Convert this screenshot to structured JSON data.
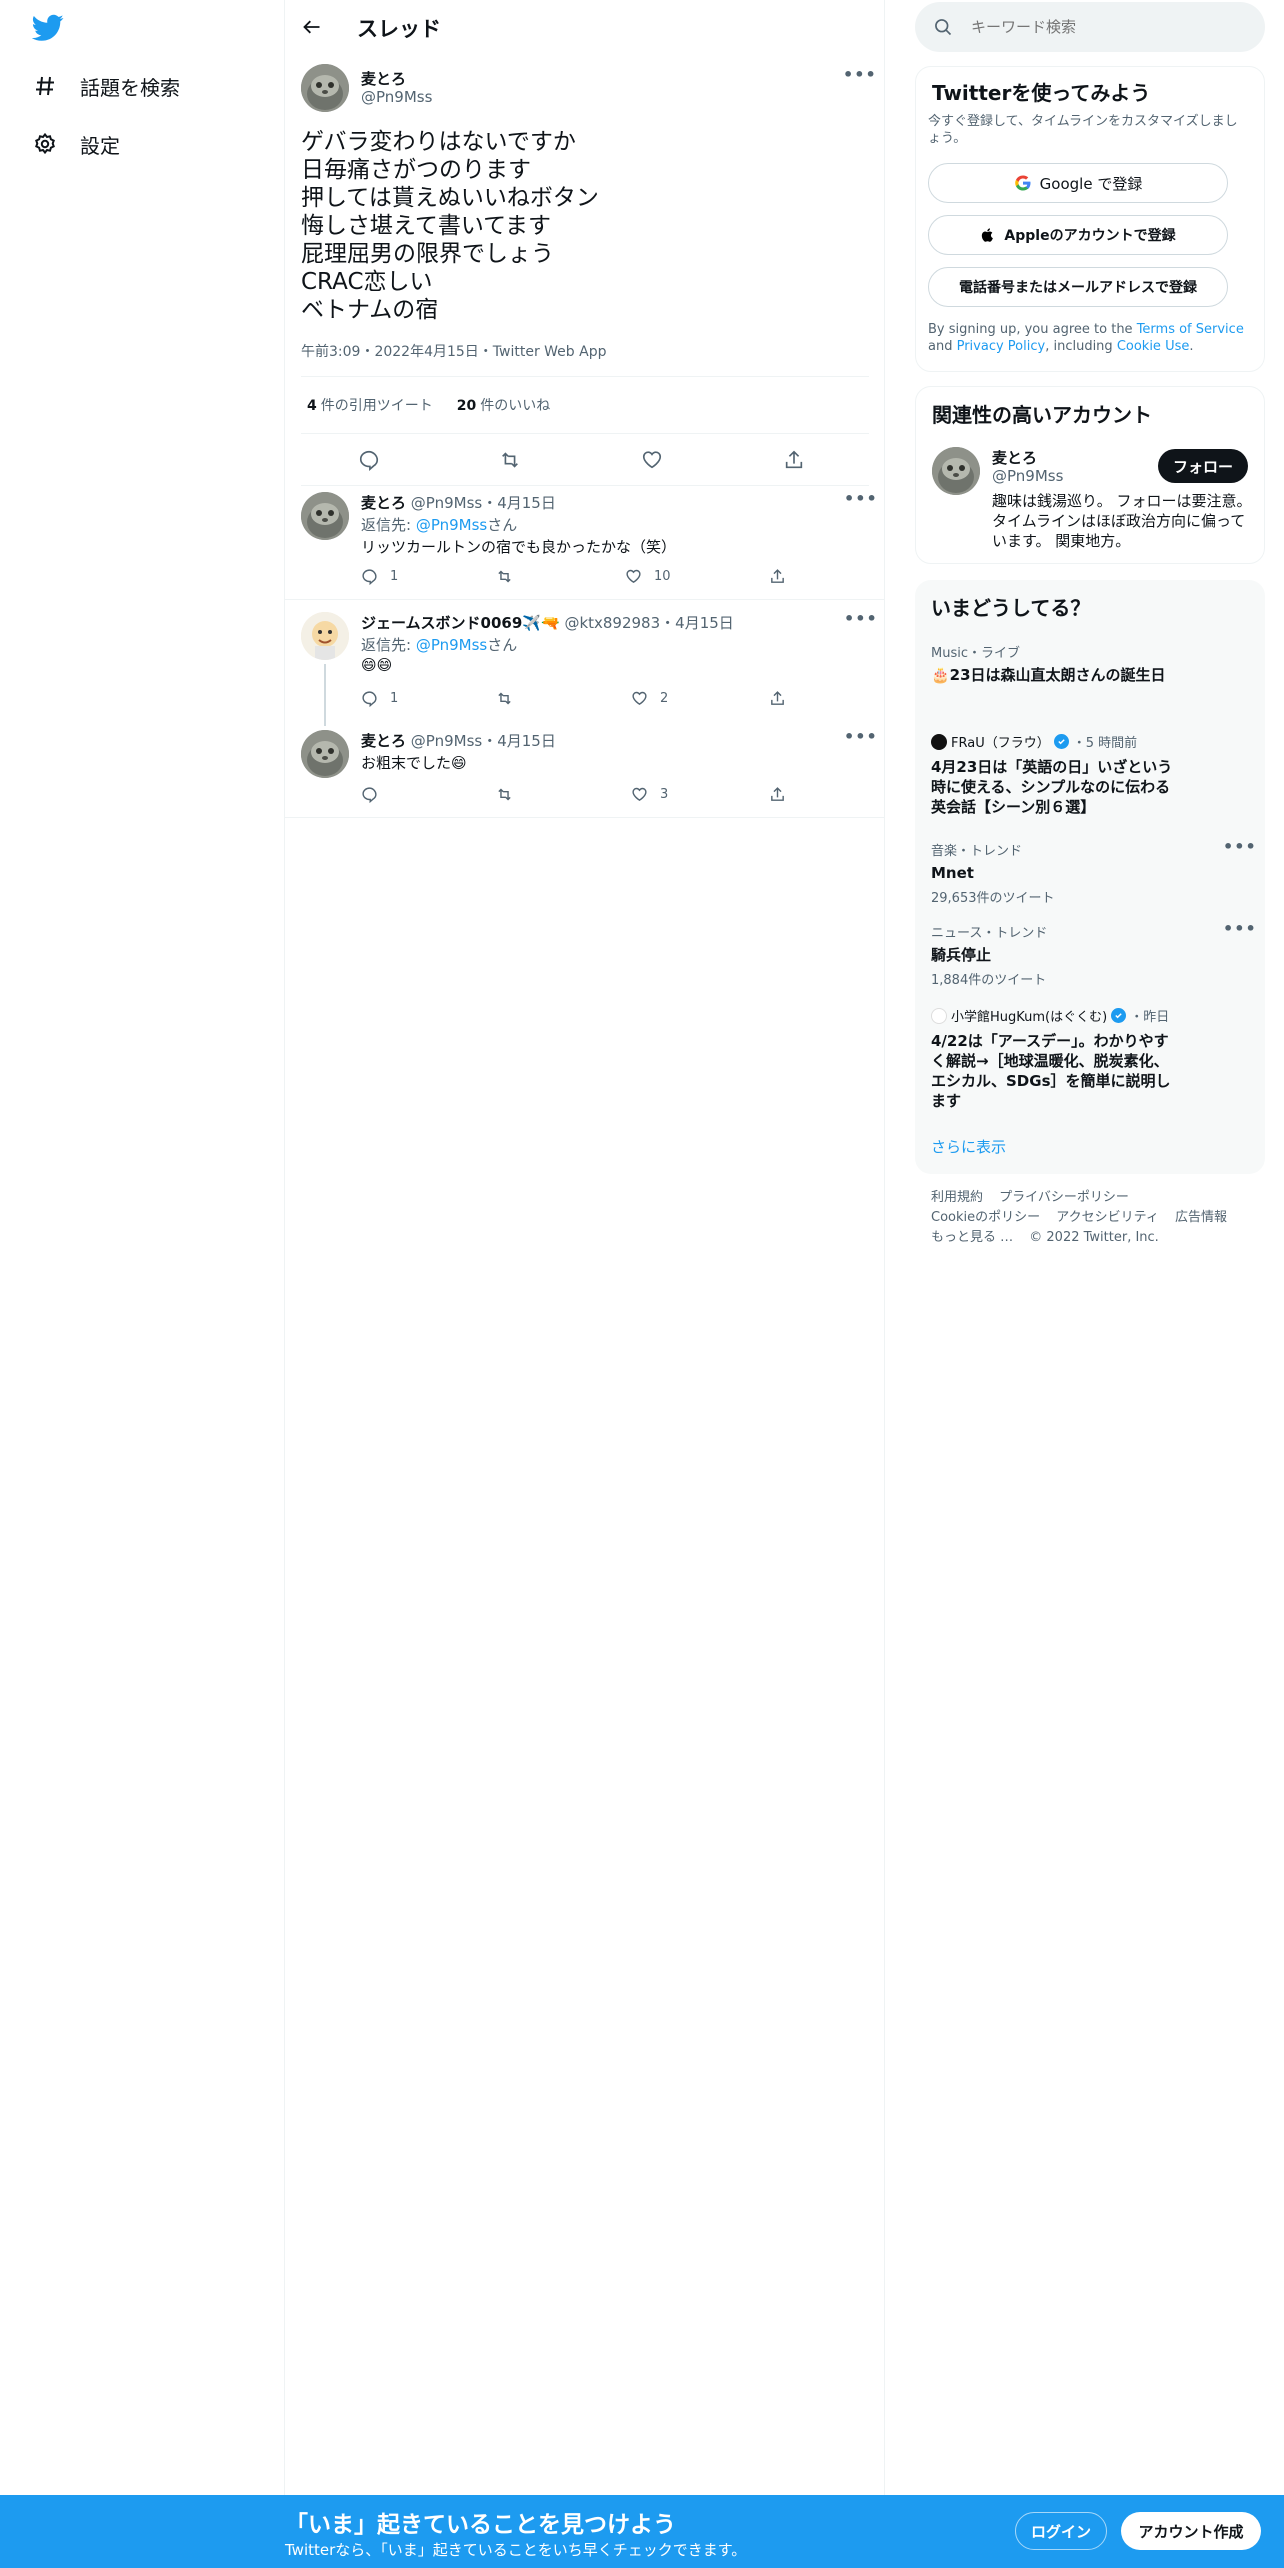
{
  "nav": {
    "items": [
      {
        "label": "話題を検索",
        "icon": "hash-icon"
      },
      {
        "label": "設定",
        "icon": "gear-icon"
      }
    ]
  },
  "header": {
    "title": "スレッド"
  },
  "tweet": {
    "name": "麦とろ",
    "handle": "@Pn9Mss",
    "text": "ゲバラ変わりはないですか\n日毎痛さがつのります\n押しては貰えぬいいねボタン\n悔しさ堪えて書いてます\n屁理屈男の限界でしょう\nCRAC恋しい\nベトナムの宿",
    "meta": "午前3:09・2022年4月15日・Twitter Web App",
    "quote_count": "4",
    "quote_label": "件の引用ツイート",
    "like_count": "20",
    "like_label": "件のいいね"
  },
  "replies": [
    {
      "name": "麦とろ",
      "handle": "@Pn9Mss",
      "date": "・4月15日",
      "reply_prefix": "返信先: ",
      "reply_to": "@Pn9Mss",
      "reply_suffix": "さん",
      "body": "リッツカールトンの宿でも良かったかな（笑）",
      "reply_count": "1",
      "retweet_count": "",
      "like_count": "10"
    },
    {
      "name": "ジェームスボンド0069✈️🔫",
      "handle": "@ktx892983",
      "date": "・4月15日",
      "reply_prefix": "返信先: ",
      "reply_to": "@Pn9Mss",
      "reply_suffix": "さん",
      "body": "😄😄",
      "reply_count": "1",
      "retweet_count": "",
      "like_count": "2"
    },
    {
      "name": "麦とろ",
      "handle": "@Pn9Mss",
      "date": "・4月15日",
      "body": "お粗末でした😄",
      "reply_count": "",
      "retweet_count": "",
      "like_count": "3"
    }
  ],
  "search": {
    "placeholder": "キーワード検索"
  },
  "signup": {
    "title": "Twitterを使ってみよう",
    "subtitle": "今すぐ登録して、タイムラインをカスタマイズしましょう。",
    "google": "Google で登録",
    "apple": "Appleのアカウントで登録",
    "phone": "電話番号またはメールアドレスで登録",
    "terms_1": "By signing up, you agree to the ",
    "terms_link1": "Terms of Service",
    "terms_2": " and ",
    "terms_link2": "Privacy Policy",
    "terms_3": ", including ",
    "terms_link3": "Cookie Use",
    "terms_4": "."
  },
  "related": {
    "title": "関連性の高いアカウント",
    "name": "麦とろ",
    "handle": "@Pn9Mss",
    "follow": "フォロー",
    "bio": "趣味は銭湯巡り。 フォローは要注意。タイムラインはほぼ政治方向に偏っています。 関東地方。"
  },
  "trends": {
    "title": "いまどうしてる？",
    "items": [
      {
        "context": "Music・ライブ",
        "title": "🎂23日は森山直太朗さんの誕生日",
        "count": ""
      },
      {
        "source": "FRaU（フラウ）",
        "time": "・5 時間前",
        "title": "4月23日は「英語の日」いざという時に使える、シンプルなのに伝わる英会話【シーン別６選】"
      },
      {
        "context": "音楽・トレンド",
        "title": "Mnet",
        "count": "29,653件のツイート"
      },
      {
        "context": "ニュース・トレンド",
        "title": "騎兵停止",
        "count": "1,884件のツイート"
      },
      {
        "source": "小学館HugKum(はぐくむ)",
        "time": "・昨日",
        "title": "4/22は「アースデー」。わかりやすく解説→［地球温暖化、脱炭素化、エシカル、SDGs］を簡単に説明します"
      }
    ],
    "show_more": "さらに表示"
  },
  "footer": {
    "links": [
      "利用規約",
      "プライバシーポリシー",
      "Cookieのポリシー",
      "アクセシビリティ",
      "広告情報",
      "もっと見る …",
      "© 2022 Twitter, Inc."
    ]
  },
  "banner": {
    "title": "「いま」起きていることを見つけよう",
    "subtitle": "Twitterなら、「いま」起きていることをいち早くチェックできます。",
    "login": "ログイン",
    "signup": "アカウント作成"
  },
  "colors": {
    "accent": "#1d9bf0",
    "text": "#0f1419",
    "muted": "#536471",
    "border": "#eff3f4"
  }
}
